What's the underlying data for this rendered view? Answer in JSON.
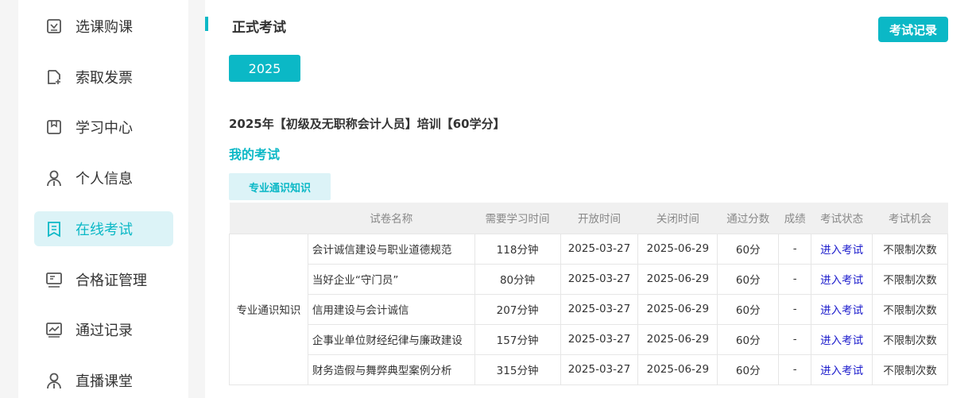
{
  "sidebar": {
    "items": [
      {
        "label": "选课购课",
        "icon": "checkbox-icon"
      },
      {
        "label": "索取发票",
        "icon": "file-add-icon"
      },
      {
        "label": "学习中心",
        "icon": "book-icon"
      },
      {
        "label": "个人信息",
        "icon": "user-icon"
      },
      {
        "label": "在线考试",
        "icon": "exam-icon",
        "active": true
      },
      {
        "label": "合格证管理",
        "icon": "certificate-icon"
      },
      {
        "label": "通过记录",
        "icon": "chart-icon"
      },
      {
        "label": "直播课堂",
        "icon": "user-icon"
      }
    ]
  },
  "main": {
    "title": "正式考试",
    "record_button": "考试记录",
    "year_tab": "2025",
    "course_title": "2025年【初级及无职称会计人员】培训【60学分】",
    "my_exam": "我的考试",
    "category_tab": "专业通识知识",
    "table": {
      "headers": [
        "",
        "试卷名称",
        "需要学习时间",
        "开放时间",
        "关闭时间",
        "通过分数",
        "成绩",
        "考试状态",
        "考试机会"
      ],
      "category": "专业通识知识",
      "rows": [
        [
          "会计诚信建设与职业道德规范",
          "118分钟",
          "2025-03-27",
          "2025-06-29",
          "60分",
          "-",
          "进入考试",
          "不限制次数"
        ],
        [
          "当好企业“守门员”",
          "80分钟",
          "2025-03-27",
          "2025-06-29",
          "60分",
          "-",
          "进入考试",
          "不限制次数"
        ],
        [
          "信用建设与会计诚信",
          "207分钟",
          "2025-03-27",
          "2025-06-29",
          "60分",
          "-",
          "进入考试",
          "不限制次数"
        ],
        [
          "企事业单位财经纪律与廉政建设",
          "157分钟",
          "2025-03-27",
          "2025-06-29",
          "60分",
          "-",
          "进入考试",
          "不限制次数"
        ],
        [
          "财务造假与舞弊典型案例分析",
          "315分钟",
          "2025-03-27",
          "2025-06-29",
          "60分",
          "-",
          "进入考试",
          "不限制次数"
        ]
      ]
    }
  }
}
